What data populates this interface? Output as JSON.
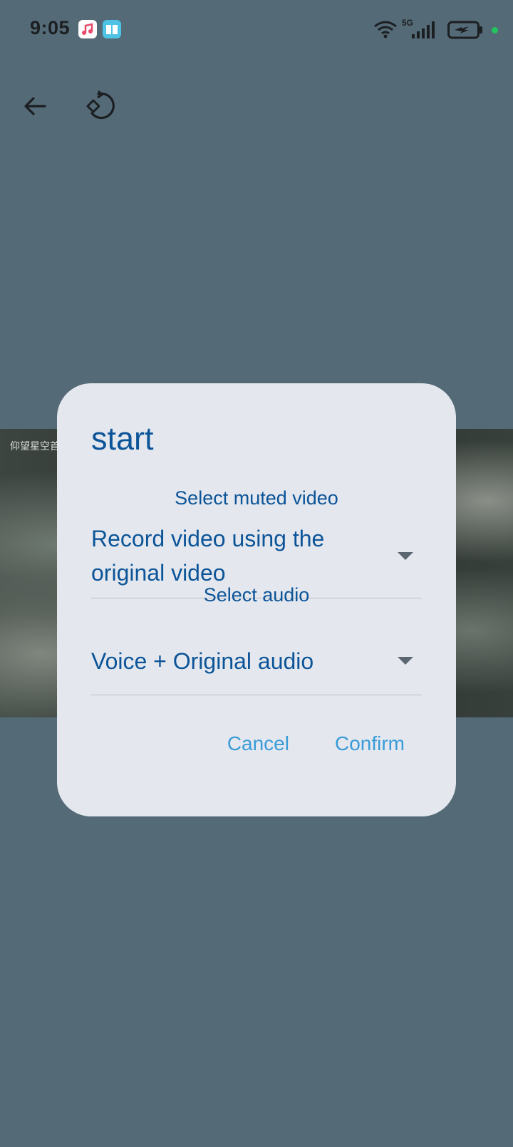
{
  "status_bar": {
    "time": "9:05",
    "network": "5G",
    "icons": [
      "music-app-icon",
      "reader-app-icon",
      "wifi-icon",
      "signal-icon",
      "battery-charging-icon"
    ]
  },
  "toolbar": {
    "icons": [
      "back-arrow-icon",
      "rotate-icon"
    ]
  },
  "video": {
    "caption": "仰望星空首"
  },
  "dialog": {
    "title": "start",
    "muted_video": {
      "label": "Select muted video",
      "value": "Record video using the original video"
    },
    "audio": {
      "label": "Select audio",
      "value": "Voice + Original audio"
    },
    "cancel_label": "Cancel",
    "confirm_label": "Confirm"
  },
  "colors": {
    "background": "#546a77",
    "dialog": "#e4e8ee",
    "primary_text": "#0c5498",
    "action_text": "#3a9bd9"
  }
}
